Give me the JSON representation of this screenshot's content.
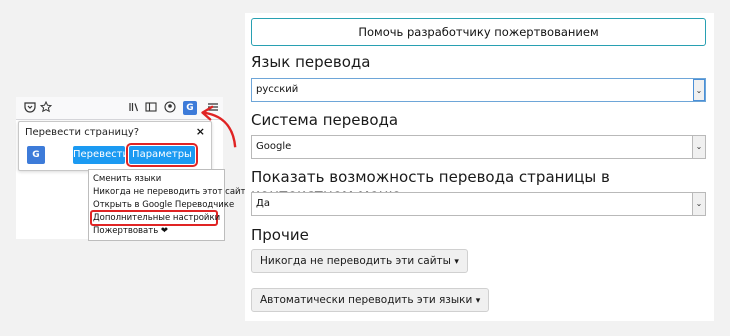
{
  "browser": {
    "toolbar_icons": [
      "pocket-icon",
      "star-icon",
      "library-icon",
      "sidebar-icon",
      "account-icon",
      "translate-extension-icon",
      "hamburger-menu-icon"
    ],
    "translate_badge": "G",
    "popup": {
      "title": "Перевести страницу?",
      "close": "×",
      "translate_button": "Перевести",
      "params_button": "Параметры",
      "params_chevron": "⌄"
    },
    "menu": {
      "items": [
        "Сменить языки",
        "Никогда не переводить этот сайт",
        "Открыть в Google Переводчике",
        "Дополнительные настройки",
        "Пожертвовать ❤"
      ],
      "highlighted_index": 3
    }
  },
  "settings": {
    "donate_button": "Помочь разработчику пожертвованием",
    "target_language": {
      "label": "Язык перевода",
      "value": "русский"
    },
    "translation_engine": {
      "label": "Система перевода",
      "value": "Google"
    },
    "context_menu": {
      "label": "Показать возможность перевода страницы в контекстном меню",
      "value": "Да"
    },
    "other": {
      "label": "Прочие",
      "never_translate_button": "Никогда не переводить эти сайты",
      "auto_translate_button": "Автоматически переводить эти языки"
    }
  },
  "colors": {
    "accent": "#1b9af2",
    "highlight_red": "#e02424",
    "donate_border": "#28a0b2",
    "page_background": "#f2f2f2"
  }
}
